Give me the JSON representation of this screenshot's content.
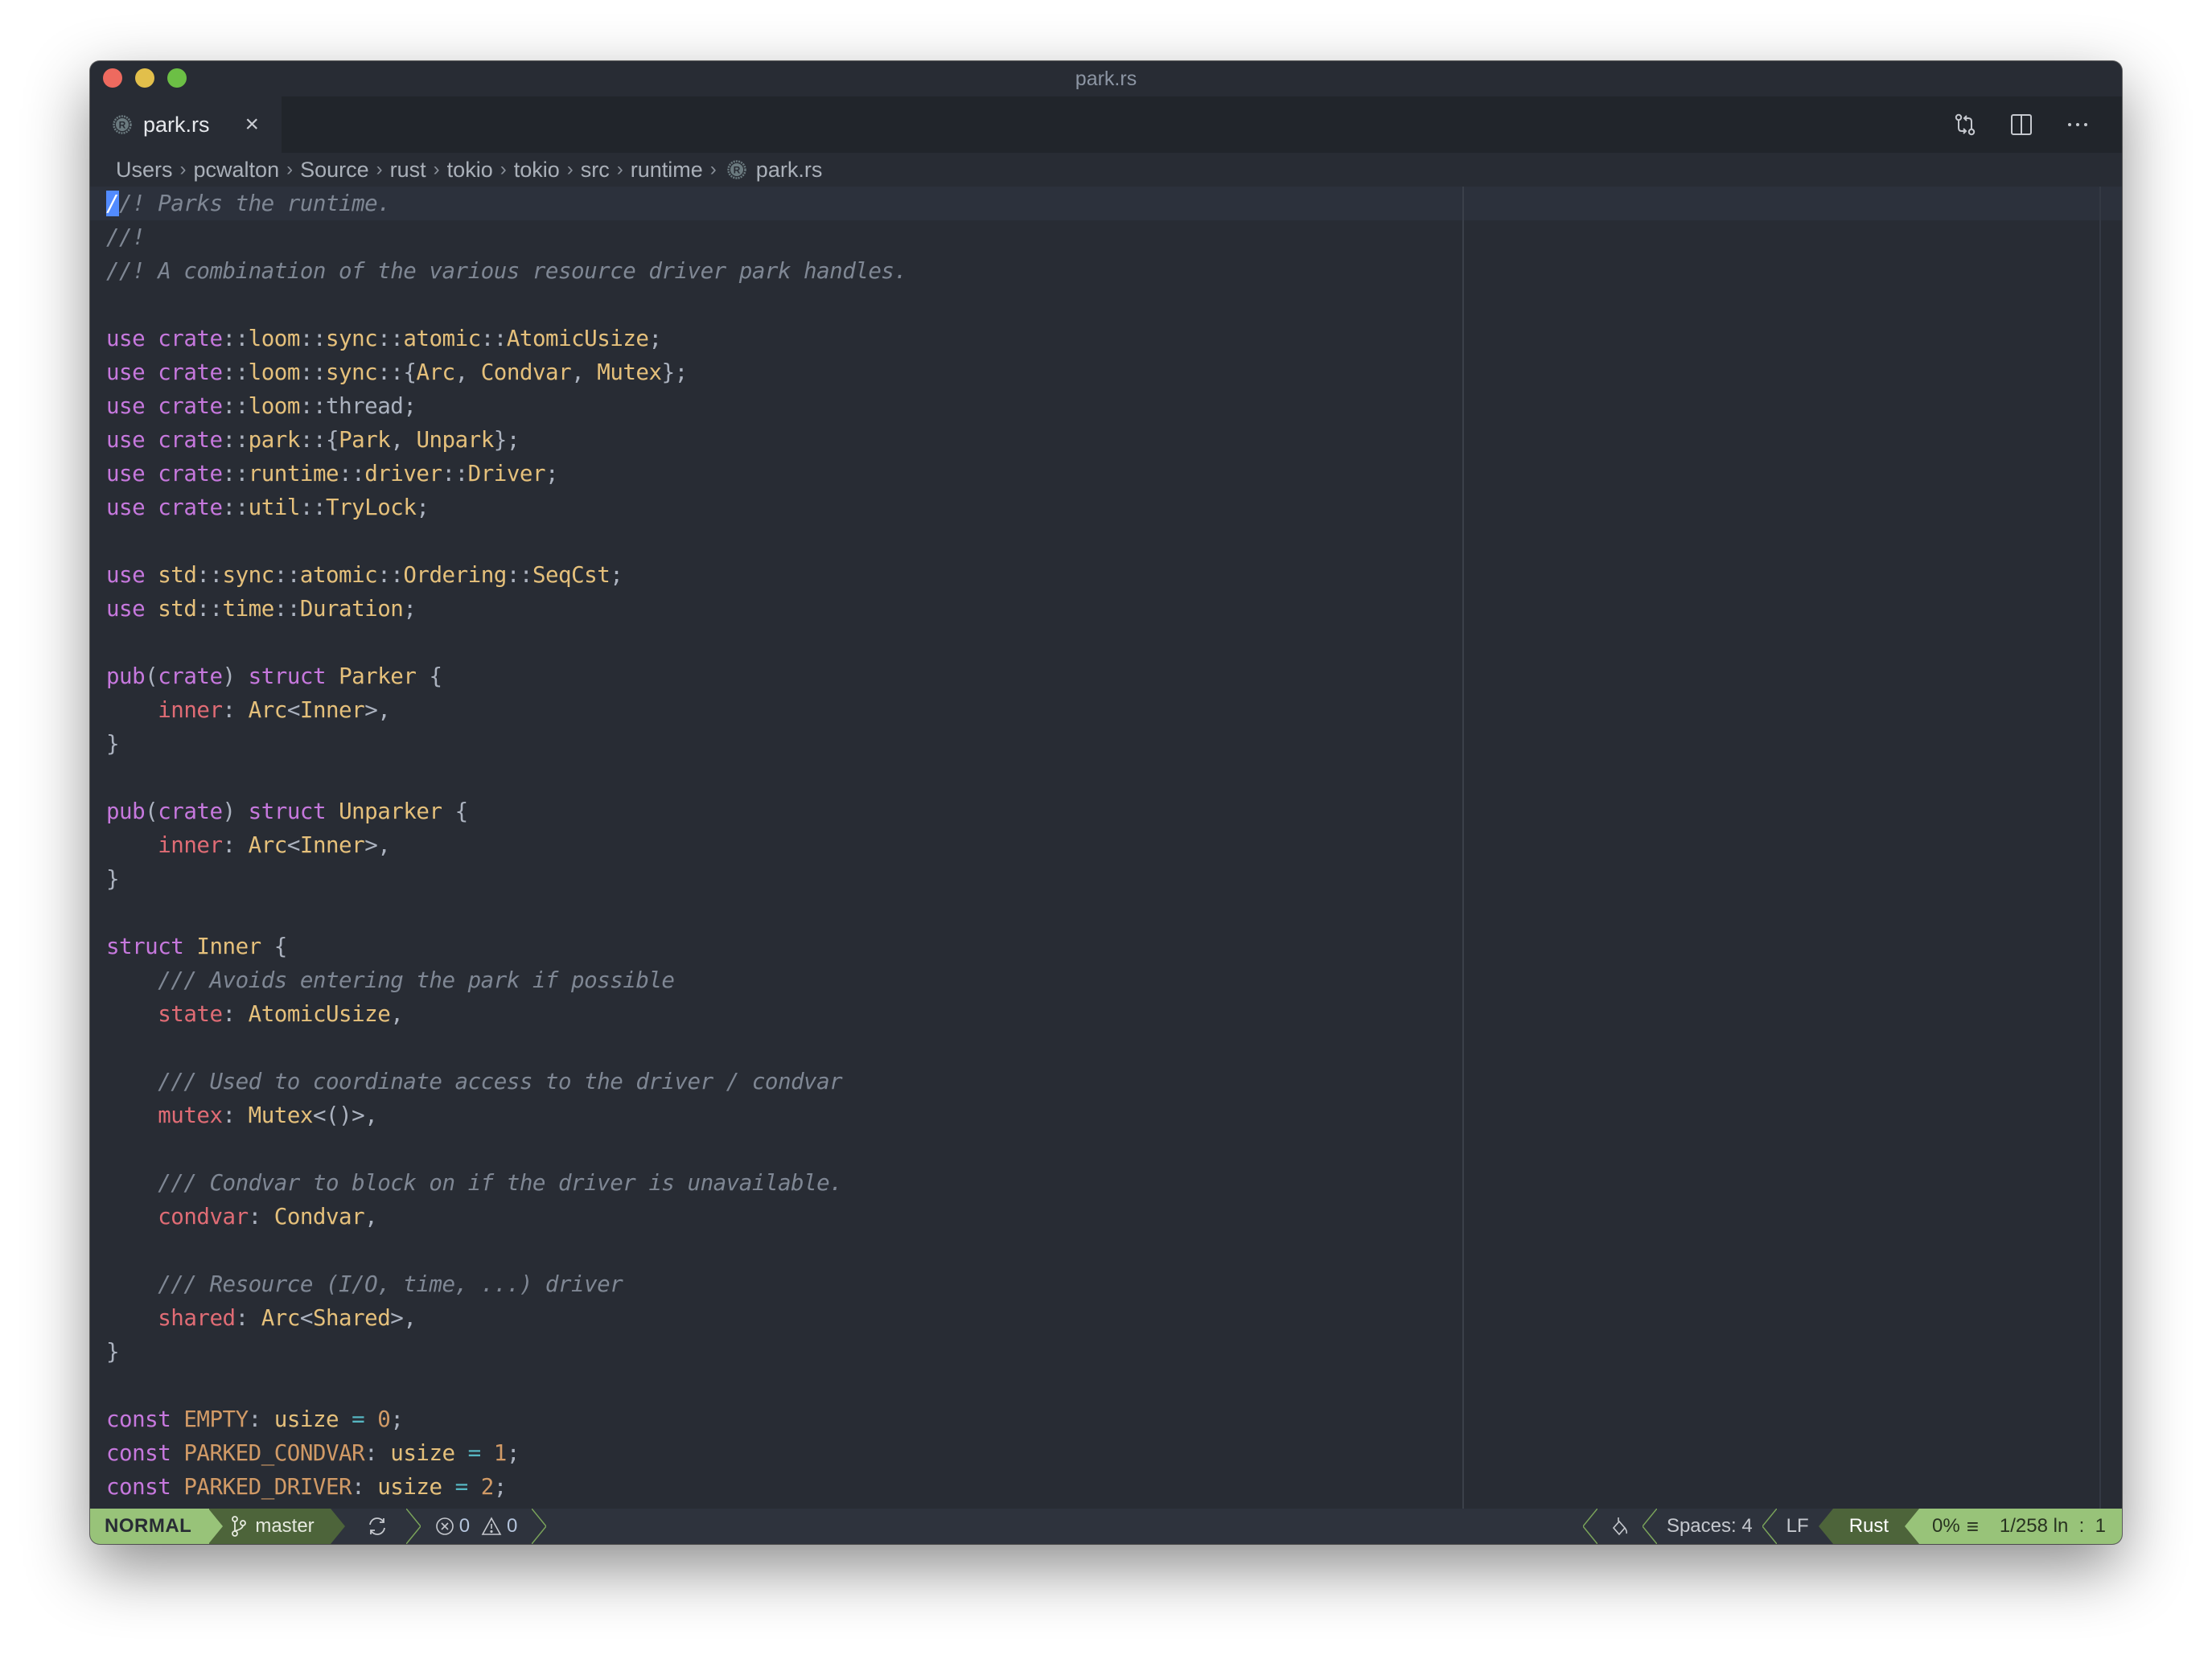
{
  "window": {
    "title": "park.rs",
    "traffic_lights": [
      "close",
      "minimize",
      "maximize"
    ]
  },
  "tabs": [
    {
      "label": "park.rs",
      "icon": "rust-icon",
      "active": true,
      "close_icon": "×"
    }
  ],
  "tab_actions": [
    {
      "name": "open-changes-icon",
      "label": "Open Changes"
    },
    {
      "name": "split-editor-icon",
      "label": "Split Editor"
    },
    {
      "name": "more-actions-icon",
      "label": "···"
    }
  ],
  "breadcrumb": [
    "Users",
    "pcwalton",
    "Source",
    "rust",
    "tokio",
    "tokio",
    "src",
    "runtime",
    "park.rs"
  ],
  "editor": {
    "language": "rust",
    "cursor": {
      "line": 1,
      "column": 1
    },
    "lines": [
      "//! Parks the runtime.",
      "//!",
      "//! A combination of the various resource driver park handles.",
      "",
      "use crate::loom::sync::atomic::AtomicUsize;",
      "use crate::loom::sync::{Arc, Condvar, Mutex};",
      "use crate::loom::thread;",
      "use crate::park::{Park, Unpark};",
      "use crate::runtime::driver::Driver;",
      "use crate::util::TryLock;",
      "",
      "use std::sync::atomic::Ordering::SeqCst;",
      "use std::time::Duration;",
      "",
      "pub(crate) struct Parker {",
      "    inner: Arc<Inner>,",
      "}",
      "",
      "pub(crate) struct Unparker {",
      "    inner: Arc<Inner>,",
      "}",
      "",
      "struct Inner {",
      "    /// Avoids entering the park if possible",
      "    state: AtomicUsize,",
      "",
      "    /// Used to coordinate access to the driver / condvar",
      "    mutex: Mutex<()>,",
      "",
      "    /// Condvar to block on if the driver is unavailable.",
      "    condvar: Condvar,",
      "",
      "    /// Resource (I/O, time, ...) driver",
      "    shared: Arc<Shared>,",
      "}",
      "",
      "const EMPTY: usize = 0;",
      "const PARKED_CONDVAR: usize = 1;",
      "const PARKED_DRIVER: usize = 2;"
    ]
  },
  "statusbar": {
    "mode": "NORMAL",
    "branch": "master",
    "errors": "0",
    "warnings": "0",
    "indentation": "Spaces: 4",
    "eol": "LF",
    "language": "Rust",
    "scroll_percent": "0%",
    "position": "1/258 ln  :  1"
  },
  "colors": {
    "mode_bg": "#98c379",
    "branch_bg": "#4d643a",
    "keyword": "#c678dd",
    "type": "#e5c07b",
    "field": "#e06c75",
    "constant": "#d19a66",
    "comment": "#7f8794",
    "caret": "#528bff"
  }
}
